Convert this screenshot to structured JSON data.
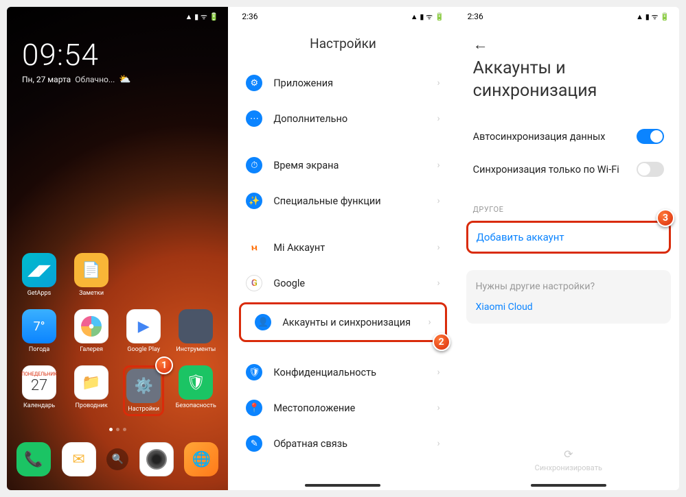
{
  "screen1": {
    "clock": {
      "time": "09:54",
      "date": "Пн, 27 марта",
      "weather_text": "Облачно..."
    },
    "apps": {
      "r1": [
        {
          "label": "GetApps"
        },
        {
          "label": "Заметки"
        }
      ],
      "r2": [
        {
          "label": "Погода",
          "val": "7°"
        },
        {
          "label": "Галерея"
        },
        {
          "label": "Google Play"
        },
        {
          "label": "Инструменты"
        }
      ],
      "r3": [
        {
          "label": "Календарь",
          "day": "ПОНЕДЕЛЬНИК",
          "num": "27"
        },
        {
          "label": "Проводник"
        },
        {
          "label": "Настройки"
        },
        {
          "label": "Безопасность"
        }
      ]
    },
    "badge1": "1"
  },
  "screen2": {
    "time": "2:36",
    "title": "Настройки",
    "items": [
      {
        "label": "Приложения",
        "color": "#0b84ff",
        "glyph": "⚙"
      },
      {
        "label": "Дополнительно",
        "color": "#0b84ff",
        "glyph": "⋯"
      },
      {
        "label": "Время экрана",
        "color": "#0b84ff",
        "glyph": "⏱"
      },
      {
        "label": "Специальные функции",
        "color": "#0b84ff",
        "glyph": "✨"
      },
      {
        "label": "Mi Аккаунт",
        "color": "#ff6b00",
        "glyph": "M"
      },
      {
        "label": "Google",
        "color": "#fff",
        "glyph": "G"
      },
      {
        "label": "Аккаунты и синхронизация",
        "color": "#0b84ff",
        "glyph": "👤",
        "hl": true
      },
      {
        "label": "Конфиденциальность",
        "color": "#0b84ff",
        "glyph": "🛡"
      },
      {
        "label": "Местоположение",
        "color": "#0b84ff",
        "glyph": "📍"
      },
      {
        "label": "Обратная связь",
        "color": "#0b84ff",
        "glyph": "✎"
      }
    ],
    "badge2": "2"
  },
  "screen3": {
    "time": "2:36",
    "title": "Аккаунты и синхронизация",
    "toggles": [
      {
        "label": "Автосинхронизация данных",
        "on": true
      },
      {
        "label": "Синхронизация только по Wi-Fi",
        "on": false
      }
    ],
    "section": "ДРУГОЕ",
    "add_account": "Добавить аккаунт",
    "card_q": "Нужны другие настройки?",
    "card_link": "Xiaomi Cloud",
    "foot": "Синхронизировать",
    "badge3": "3"
  }
}
